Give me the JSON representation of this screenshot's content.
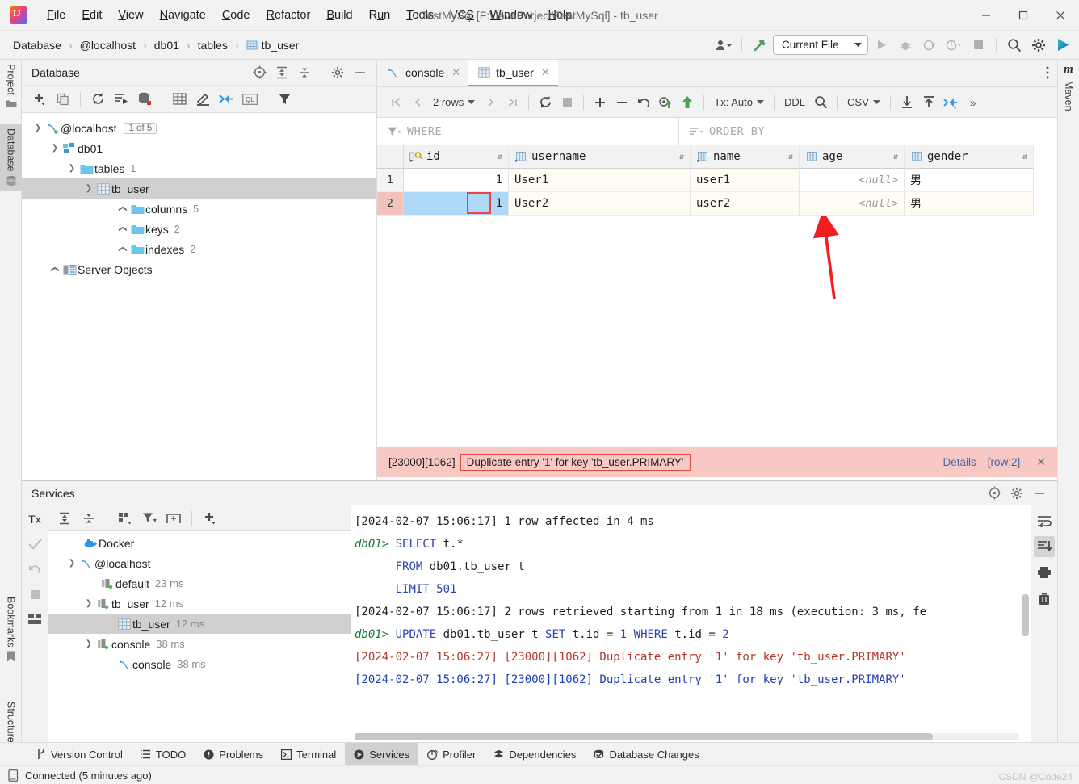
{
  "window": {
    "title": "TestMySql [F:\\JavaPorject\\TestMySql] - tb_user",
    "minimize": "—",
    "maximize": "▢",
    "close": "✕"
  },
  "menubar": {
    "items": [
      {
        "label": "File",
        "accel": "F"
      },
      {
        "label": "Edit",
        "accel": "E"
      },
      {
        "label": "View",
        "accel": "V"
      },
      {
        "label": "Navigate",
        "accel": "N"
      },
      {
        "label": "Code",
        "accel": "C"
      },
      {
        "label": "Refactor",
        "accel": "R"
      },
      {
        "label": "Build",
        "accel": "B"
      },
      {
        "label": "Run",
        "accel": "u"
      },
      {
        "label": "Tools",
        "accel": "T"
      },
      {
        "label": "VCS",
        "accel": "S"
      },
      {
        "label": "Window",
        "accel": "W"
      },
      {
        "label": "Help",
        "accel": "H"
      }
    ]
  },
  "navbar": {
    "breadcrumbs": [
      "Database",
      "@localhost",
      "db01",
      "tables",
      "tb_user"
    ],
    "separator": "›",
    "run_config": "Current File",
    "icons": [
      "user-dropdown-icon",
      "hammer-build-icon",
      "run-icon",
      "debug-icon",
      "run-with-coverage-icon",
      "profile-icon",
      "stop-icon",
      "search-everywhere-icon",
      "settings-icon",
      "updates-icon"
    ]
  },
  "left_tool_strip": {
    "tabs": [
      {
        "label": "Project",
        "icon": "project-folder-icon",
        "selected": false
      },
      {
        "label": "Database",
        "icon": "database-icon",
        "selected": true
      },
      {
        "label": "Bookmarks",
        "icon": "bookmark-icon",
        "selected": false
      },
      {
        "label": "Structure",
        "icon": "structure-icon",
        "selected": false
      }
    ]
  },
  "right_tool_strip": {
    "tabs": [
      {
        "label": "Maven",
        "icon": "maven-m-icon"
      }
    ]
  },
  "database_panel": {
    "title": "Database",
    "header_icons": [
      "scroll-from-source-icon",
      "expand-all-icon",
      "collapse-all-icon",
      "gear-icon",
      "hide-icon"
    ],
    "toolbar_icons": [
      "add-icon",
      "copy-icon",
      "refresh-icon",
      "run-sql-icon",
      "sync-db-icon",
      "table-editor-icon",
      "modify-icon",
      "jump-to-editor-icon",
      "query-console-icon",
      "filter-icon"
    ],
    "tree": [
      {
        "label": "@localhost",
        "icon": "mysql-connection-icon",
        "badge": "1 of 5",
        "indent": 0,
        "twisty": "down"
      },
      {
        "label": "db01",
        "icon": "schema-icon",
        "indent": 1,
        "twisty": "down"
      },
      {
        "label": "tables",
        "icon": "folder-icon",
        "count": "1",
        "indent": 2,
        "twisty": "down"
      },
      {
        "label": "tb_user",
        "icon": "table-icon",
        "indent": 3,
        "twisty": "down",
        "selected": true
      },
      {
        "label": "columns",
        "icon": "folder-icon",
        "count": "5",
        "indent": 4,
        "twisty": "right"
      },
      {
        "label": "keys",
        "icon": "folder-icon",
        "count": "2",
        "indent": 4,
        "twisty": "right"
      },
      {
        "label": "indexes",
        "icon": "folder-icon",
        "count": "2",
        "indent": 4,
        "twisty": "right"
      },
      {
        "label": "Server Objects",
        "icon": "server-objects-icon",
        "indent": 1,
        "twisty": "right"
      }
    ]
  },
  "editor": {
    "tabs": [
      {
        "label": "console",
        "icon": "console-icon",
        "active": false,
        "close": "✕"
      },
      {
        "label": "tb_user",
        "icon": "table-icon",
        "active": true,
        "close": "✕"
      }
    ],
    "grid_toolbar": {
      "first_page": "|◀",
      "prev_page": "‹",
      "rows_label": "2 rows",
      "next_page": "›",
      "last_page": "▶|",
      "reload": "reload-icon",
      "stop": "stop-icon",
      "add_row": "+",
      "delete_row": "−",
      "revert": "revert-icon",
      "submit_preview": "preview-changes-icon",
      "submit": "submit-icon",
      "tx_label": "Tx: Auto",
      "ddl": "DDL",
      "search": "search-icon",
      "csv_label": "CSV",
      "import": "import-icon",
      "export": "export-icon",
      "edit_maximized": "value-editor-icon",
      "overflow": "»"
    },
    "filters": {
      "where": "WHERE",
      "order_by": "ORDER BY"
    },
    "grid": {
      "columns": [
        {
          "name": "id",
          "icon": "primary-key-column-icon",
          "sortable": true
        },
        {
          "name": "username",
          "icon": "column-icon",
          "sortable": true
        },
        {
          "name": "name",
          "icon": "column-icon",
          "sortable": true
        },
        {
          "name": "age",
          "icon": "column-icon",
          "sortable": true
        },
        {
          "name": "gender",
          "icon": "column-icon",
          "sortable": true
        }
      ],
      "rows": [
        {
          "num": "1",
          "id": "1",
          "username": "User1",
          "name": "user1",
          "age": "<null>",
          "gender": "男",
          "error": false
        },
        {
          "num": "2",
          "id": "1",
          "username": "User2",
          "name": "user2",
          "age": "<null>",
          "gender": "男",
          "error": true
        }
      ],
      "selected_cell": {
        "row": 2,
        "column": "id"
      }
    },
    "error_bar": {
      "code": "[23000][1062]",
      "message": "Duplicate entry '1' for key 'tb_user.PRIMARY'",
      "details_link": "Details",
      "row_link": "[row:2]",
      "close": "✕"
    }
  },
  "services": {
    "title": "Services",
    "header_icons": [
      "scroll-from-source-icon",
      "gear-icon",
      "hide-icon"
    ],
    "left_tools": [
      "Tx",
      "commit-icon",
      "rollback-icon",
      "stop-icon",
      "layout-icon"
    ],
    "tree_toolbar_icons": [
      "expand-all-icon",
      "collapse-all-icon",
      "group-by-icon",
      "filter-icon",
      "add-tab-icon",
      "add-icon"
    ],
    "tree": [
      {
        "label": "Docker",
        "icon": "docker-icon",
        "indent": 1,
        "twisty": "none"
      },
      {
        "label": "@localhost",
        "icon": "mysql-connection-icon",
        "indent": 1,
        "twisty": "down"
      },
      {
        "label": "default",
        "time": "23 ms",
        "icon": "session-icon",
        "indent": 2,
        "twisty": "none"
      },
      {
        "label": "tb_user",
        "time": "12 ms",
        "icon": "session-icon",
        "indent": 2,
        "twisty": "down"
      },
      {
        "label": "tb_user",
        "time": "12 ms",
        "icon": "table-icon",
        "indent": 3,
        "twisty": "none",
        "selected": true
      },
      {
        "label": "console",
        "time": "38 ms",
        "icon": "session-icon",
        "indent": 2,
        "twisty": "down"
      },
      {
        "label": "console",
        "time": "38 ms",
        "icon": "console-icon",
        "indent": 3,
        "twisty": "none"
      }
    ],
    "console_lines": [
      {
        "type": "plain",
        "text": "[2024-02-07 15:06:17] 1 row affected in 4 ms"
      },
      {
        "type": "query",
        "prompt": "db01>",
        "parts": [
          {
            "c": "kw",
            "t": " SELECT"
          },
          {
            "c": "plain",
            "t": " t.*"
          }
        ]
      },
      {
        "type": "query",
        "prompt": "     ",
        "parts": [
          {
            "c": "kw",
            "t": " FROM"
          },
          {
            "c": "plain",
            "t": " db01.tb_user t"
          }
        ]
      },
      {
        "type": "query",
        "prompt": "     ",
        "parts": [
          {
            "c": "kw",
            "t": " LIMIT"
          },
          {
            "c": "num",
            "t": " 501"
          }
        ]
      },
      {
        "type": "plain",
        "text": "[2024-02-07 15:06:17] 2 rows retrieved starting from 1 in 18 ms (execution: 3 ms, fe"
      },
      {
        "type": "query",
        "prompt": "db01>",
        "parts": [
          {
            "c": "kw",
            "t": " UPDATE"
          },
          {
            "c": "plain",
            "t": " db01.tb_user t "
          },
          {
            "c": "kw",
            "t": "SET"
          },
          {
            "c": "plain",
            "t": " t.id = "
          },
          {
            "c": "num",
            "t": "1"
          },
          {
            "c": "plain",
            "t": " "
          },
          {
            "c": "kw",
            "t": "WHERE"
          },
          {
            "c": "plain",
            "t": " t.id = "
          },
          {
            "c": "num",
            "t": "2"
          }
        ]
      },
      {
        "type": "error",
        "text": "[2024-02-07 15:06:27] [23000][1062] Duplicate entry '1' for key 'tb_user.PRIMARY'"
      },
      {
        "type": "errorblue",
        "text": "[2024-02-07 15:06:27] [23000][1062] Duplicate entry '1' for key 'tb_user.PRIMARY'"
      }
    ],
    "right_tools": [
      "soft-wrap-icon",
      "scroll-to-end-icon",
      "print-icon",
      "clear-all-icon"
    ]
  },
  "bottom_bar": {
    "tabs": [
      {
        "label": "Version Control",
        "icon": "branch-icon",
        "selected": false
      },
      {
        "label": "TODO",
        "icon": "todo-icon",
        "selected": false
      },
      {
        "label": "Problems",
        "icon": "problems-icon",
        "selected": false
      },
      {
        "label": "Terminal",
        "icon": "terminal-icon",
        "selected": false
      },
      {
        "label": "Services",
        "icon": "services-icon",
        "selected": true
      },
      {
        "label": "Profiler",
        "icon": "profiler-icon",
        "selected": false
      },
      {
        "label": "Dependencies",
        "icon": "dependencies-icon",
        "selected": false
      },
      {
        "label": "Database Changes",
        "icon": "database-changes-icon",
        "selected": false
      }
    ]
  },
  "status_bar": {
    "icon": "db-connected-icon",
    "text": "Connected (5 minutes ago)",
    "watermark": "CSDN @Code24"
  },
  "colors": {
    "accent_blue": "#3f69a8",
    "error_bg": "#f8c8c4",
    "error_border": "#e04a3f",
    "selection_blue": "#add8f7",
    "error_row_gutter": "#f2c3bd",
    "keyword_blue": "#2b43b5",
    "prompt_green": "#0f7a32",
    "error_red": "#b5352c",
    "annotation_red": "#f01e1e"
  }
}
